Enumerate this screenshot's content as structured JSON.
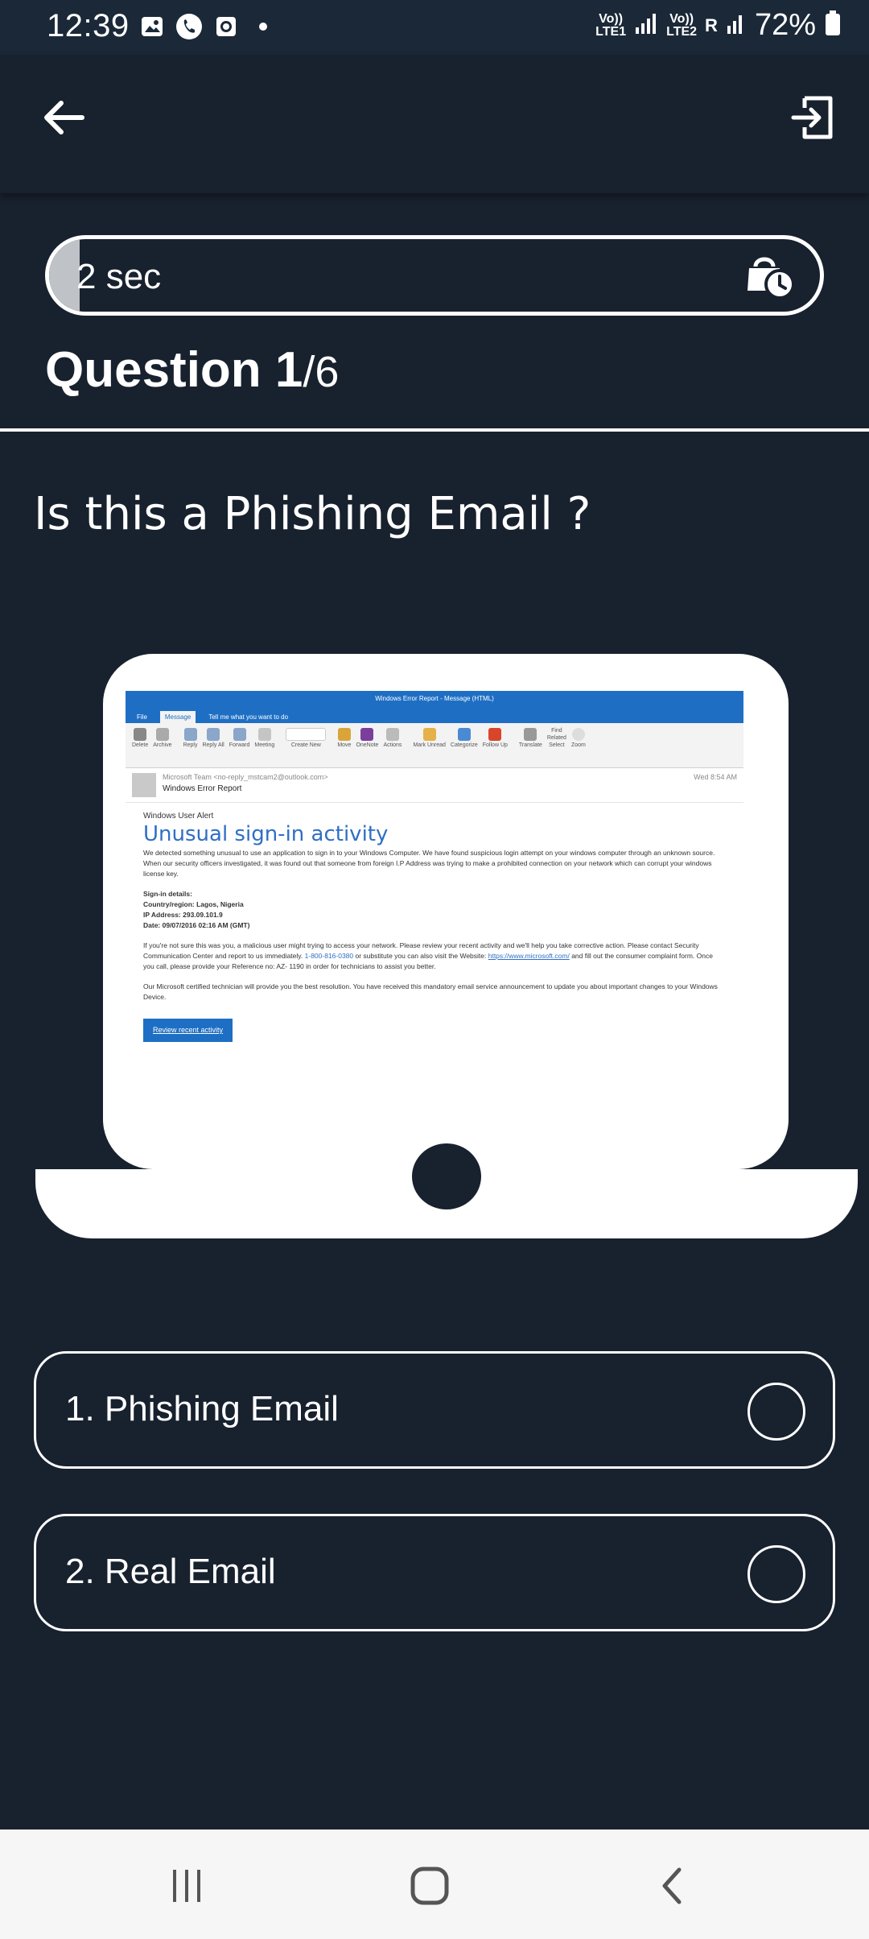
{
  "status_bar": {
    "time": "12:39",
    "sim1_top": "Vo))",
    "sim1_bottom": "LTE1",
    "sim2_top": "Vo))",
    "sim2_bottom": "LTE2",
    "roaming": "R",
    "battery": "72%"
  },
  "timer": {
    "text": "2 sec",
    "remaining_fraction": 0.04
  },
  "question": {
    "label": "Question 1",
    "total": "/6",
    "text": "Is this a Phishing Email ?"
  },
  "email": {
    "window_title": "Windows Error Report - Message (HTML)",
    "tabs": [
      "File",
      "Message",
      "Tell me what you want to do"
    ],
    "ribbon": [
      "Delete",
      "Archive",
      "Reply",
      "Reply All",
      "Forward",
      "Meeting",
      "Create New",
      "Move",
      "OneNote",
      "Actions",
      "Mark Unread",
      "Categorize",
      "Follow Up",
      "Translate",
      "Find",
      "Related",
      "Select",
      "Zoom"
    ],
    "sender": "Microsoft Team <no-reply_mstcam2@outlook.com>",
    "date": "Wed 8:54 AM",
    "subject": "Windows Error Report",
    "alert_label": "Windows User Alert",
    "heading": "Unusual sign-in activity",
    "para1": "We detected something unusual to use an application to sign in to your Windows Computer. We have found suspicious login attempt on your windows computer through an unknown source. When our security officers investigated, it was found out that someone from foreign I.P Address was trying to make a prohibited connection on your network which can corrupt your windows license key.",
    "details_title": "Sign-in details:",
    "details_country": "Country/region: Lagos, Nigeria",
    "details_ip": "IP Address: 293.09.101.9",
    "details_date": "Date: 09/07/2016 02:16 AM (GMT)",
    "para2_a": "If you're not sure this was you, a malicious user might trying to access your network. Please review your recent activity and we'll help you take corrective action. Please contact Security Communication Center and report to us immediately.",
    "para2_phone": "1-800-816-0380",
    "para2_b": "or substitute you can also visit the Website:",
    "para2_link": "https://www.microsoft.com/",
    "para2_c": "and fill out the consumer complaint form. Once you call, please provide your Reference no: AZ- 1190 in order for technicians to assist you better.",
    "para3": "Our Microsoft certified technician will provide you the best resolution. You have received this mandatory email service announcement to update you about important changes to your Windows Device.",
    "button": "Review recent activity"
  },
  "options": [
    {
      "label": "1. Phishing Email"
    },
    {
      "label": "2. Real Email"
    }
  ],
  "colors": {
    "background": "#18212e",
    "status_bar": "#1b2838",
    "accent": "#ffffff",
    "outlook_blue": "#1e6fc4"
  }
}
